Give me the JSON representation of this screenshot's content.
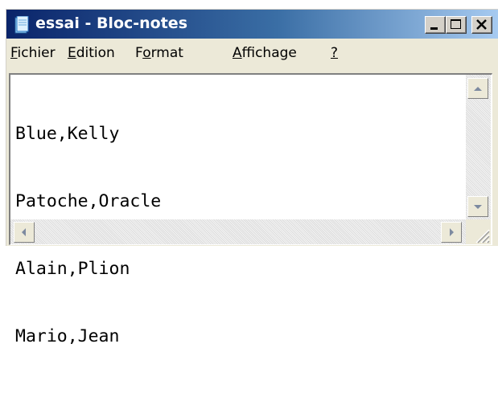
{
  "window": {
    "title": "essai - Bloc-notes",
    "icon": "notepad-icon"
  },
  "caption_buttons": [
    "minimize-icon",
    "maximize-icon",
    "close-icon"
  ],
  "menu": [
    {
      "label": "Fichier",
      "access_key": "F"
    },
    {
      "label": "Edition",
      "access_key": "E"
    },
    {
      "label": "Format",
      "access_key": "o"
    },
    {
      "label": "Affichage",
      "access_key": "A"
    },
    {
      "label": "?",
      "access_key": "?"
    }
  ],
  "editor": {
    "lines": [
      "Blue,Kelly",
      "Patoche,Oracle",
      "Alain,Plion",
      "Mario,Jean"
    ]
  },
  "colors": {
    "titlebar_start": "#0a246a",
    "titlebar_end": "#a6caf0",
    "chrome": "#ece9d8"
  }
}
